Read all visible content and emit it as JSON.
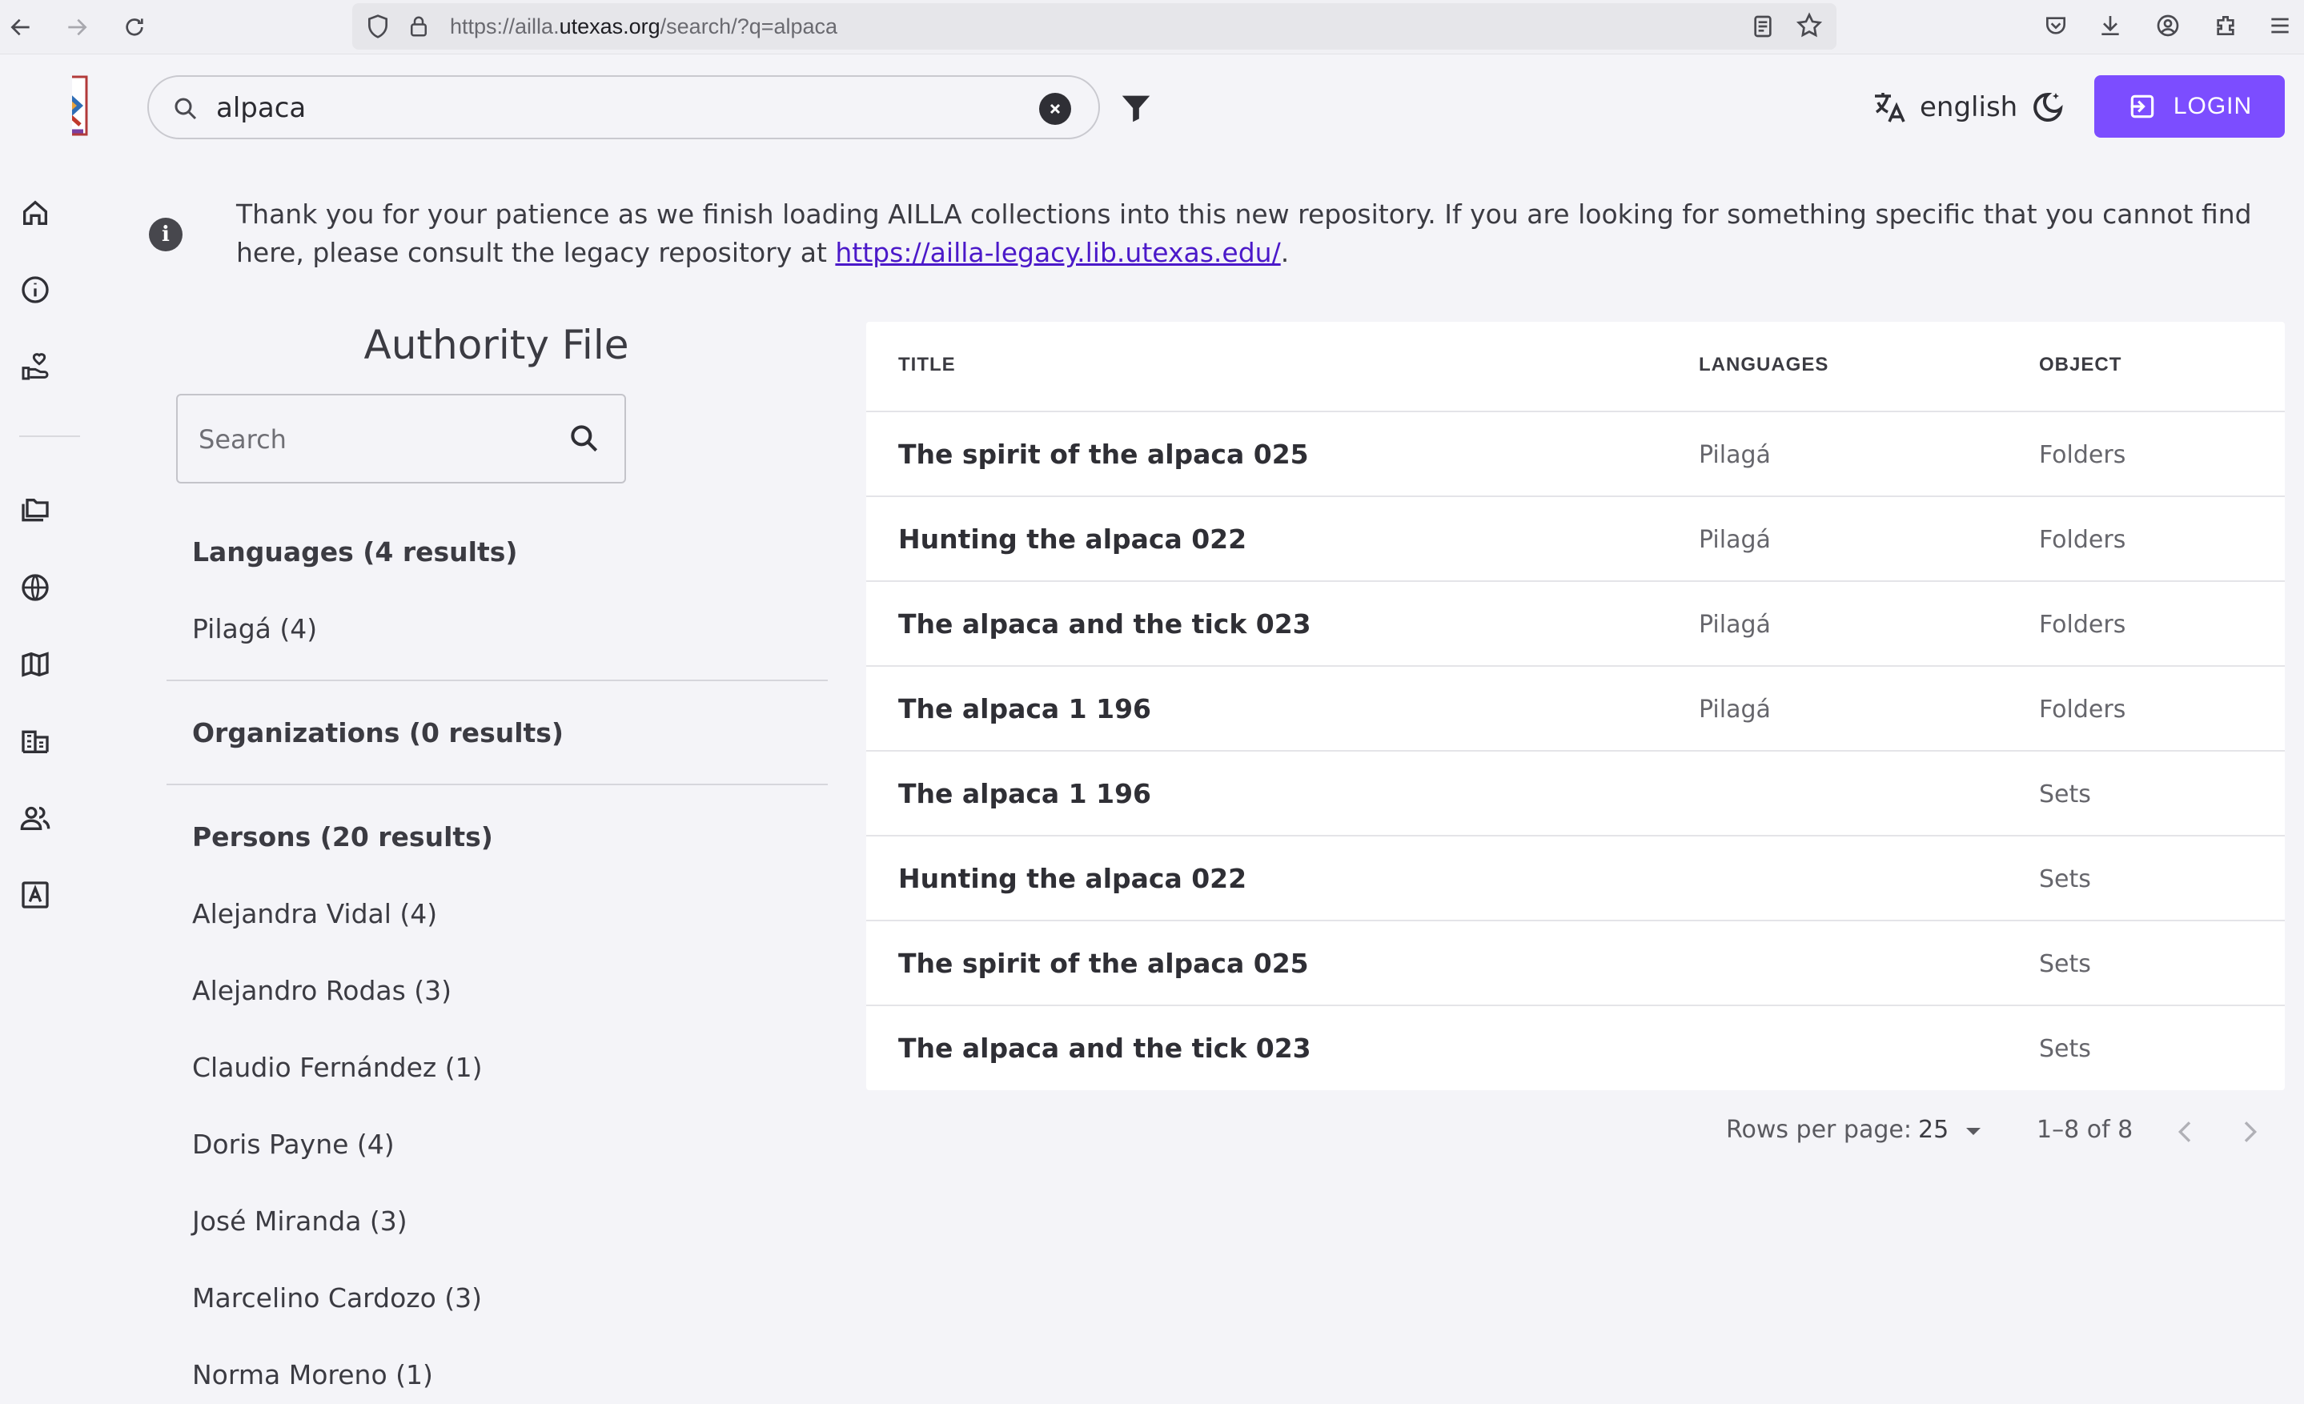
{
  "browser": {
    "url_prefix": "https://ailla.",
    "url_host": "utexas.org",
    "url_suffix": "/search/?q=alpaca"
  },
  "header": {
    "search_value": "alpaca",
    "language_label": "english",
    "login_label": "LOGIN",
    "accent_color": "#7c4dff"
  },
  "notice": {
    "text": "Thank you for your patience as we finish loading AILLA collections into this new repository. If you are looking for something specific that you cannot find here, please consult the legacy repository at ",
    "link_text": "https://ailla-legacy.lib.utexas.edu/",
    "trailing": "."
  },
  "authority": {
    "title": "Authority File",
    "search_placeholder": "Search",
    "languages_heading": "Languages (4 results)",
    "languages": [
      "Pilagá (4)"
    ],
    "organizations_heading": "Organizations (0 results)",
    "persons_heading": "Persons (20 results)",
    "persons": [
      "Alejandra Vidal (4)",
      "Alejandro Rodas (3)",
      "Claudio Fernández (1)",
      "Doris Payne (4)",
      "José Miranda (3)",
      "Marcelino Cardozo (3)",
      "Norma Moreno (1)"
    ]
  },
  "table": {
    "columns": [
      "TITLE",
      "LANGUAGES",
      "OBJECT"
    ],
    "rows": [
      {
        "title": "The spirit of the alpaca 025",
        "language": "Pilagá",
        "object": "Folders"
      },
      {
        "title": "Hunting the alpaca 022",
        "language": "Pilagá",
        "object": "Folders"
      },
      {
        "title": "The alpaca and the tick 023",
        "language": "Pilagá",
        "object": "Folders"
      },
      {
        "title": "The alpaca 1 196",
        "language": "Pilagá",
        "object": "Folders"
      },
      {
        "title": "The alpaca 1 196",
        "language": "",
        "object": "Sets"
      },
      {
        "title": "Hunting the alpaca 022",
        "language": "",
        "object": "Sets"
      },
      {
        "title": "The spirit of the alpaca 025",
        "language": "",
        "object": "Sets"
      },
      {
        "title": "The alpaca and the tick 023",
        "language": "",
        "object": "Sets"
      }
    ],
    "rows_per_page_label": "Rows per page:",
    "rows_per_page_value": "25",
    "range_label": "1–8 of 8"
  },
  "icons": {
    "rail": [
      "home-icon",
      "info-icon",
      "donate-icon",
      "collections-icon",
      "globe-icon",
      "map-icon",
      "organizations-icon",
      "persons-icon",
      "alphabet-icon"
    ]
  }
}
